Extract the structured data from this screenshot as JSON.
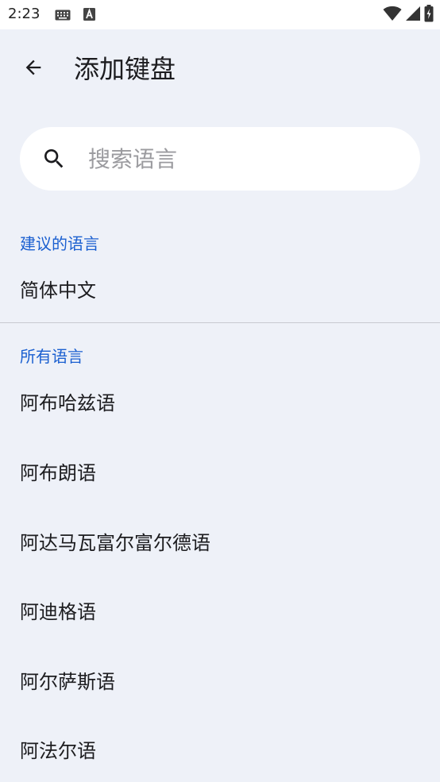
{
  "status_bar": {
    "time": "2:23",
    "icons": [
      "keyboard-icon",
      "a-icon",
      "wifi-icon",
      "signal-icon",
      "battery-icon"
    ]
  },
  "app_bar": {
    "back_icon": "arrow-left-icon",
    "title": "添加键盘"
  },
  "search": {
    "icon": "search-icon",
    "placeholder": "搜索语言",
    "value": ""
  },
  "suggested": {
    "header": "建议的语言",
    "items": [
      {
        "label": "简体中文"
      }
    ]
  },
  "all": {
    "header": "所有语言",
    "items": [
      {
        "label": "阿布哈兹语"
      },
      {
        "label": "阿布朗语"
      },
      {
        "label": "阿达马瓦富尔富尔德语"
      },
      {
        "label": "阿迪格语"
      },
      {
        "label": "阿尔萨斯语"
      },
      {
        "label": "阿法尔语"
      }
    ]
  },
  "colors": {
    "background": "#eef1f8",
    "accent": "#1a5fd0",
    "status_bar": "#ffffff"
  }
}
